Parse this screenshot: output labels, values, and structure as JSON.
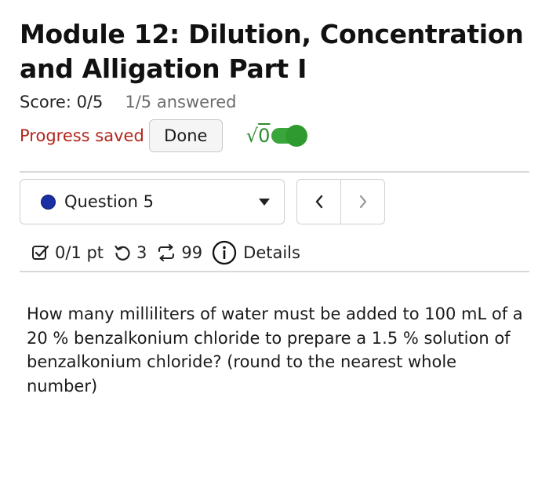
{
  "header": {
    "title": "Module 12: Dilution, Concentration and Alligation Part I",
    "score": "Score: 0/5",
    "answered": "1/5 answered"
  },
  "progress": {
    "status": "Progress saved",
    "done_label": "Done",
    "math_icon": "sqrt-icon",
    "math_label": "√0",
    "toggle_on": true
  },
  "question_nav": {
    "selected": "Question 5",
    "prev_label": "‹",
    "next_label": "›"
  },
  "meta": {
    "points": "0/1 pt",
    "attempts": "3",
    "submissions": "99",
    "details_label": "Details"
  },
  "question": {
    "text": "How many milliliters of water must be added to 100 mL of a 20 % benzalkonium chloride to prepare a 1.5 % solution of benzalkonium chloride? (round to the nearest whole number)"
  },
  "colors": {
    "progress_text": "#b3261e",
    "toggle": "#3aa53a",
    "question_dot": "#1a2fa6"
  }
}
